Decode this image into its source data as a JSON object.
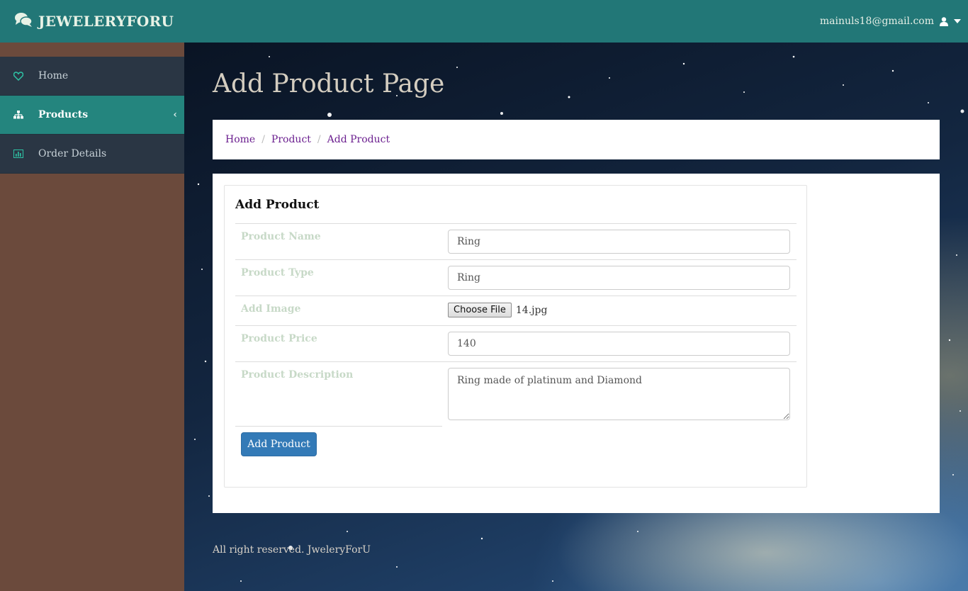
{
  "header": {
    "brand": "JEWELERYFORU",
    "user_email": "mainuls18@gmail.com"
  },
  "sidebar": {
    "items": [
      {
        "label": "Home",
        "icon": "heart-icon"
      },
      {
        "label": "Products",
        "icon": "sitemap-icon",
        "active": true
      },
      {
        "label": "Order Details",
        "icon": "bar-chart-icon"
      }
    ]
  },
  "page": {
    "title": "Add Product Page",
    "breadcrumb": [
      "Home",
      "Product",
      "Add Product"
    ],
    "footer": "All right reserved. JweleryForU"
  },
  "form": {
    "title": "Add Product",
    "product_name": {
      "label": "Product Name",
      "value": "Ring"
    },
    "product_type": {
      "label": "Product Type",
      "value": "Ring"
    },
    "image": {
      "label": "Add Image",
      "button": "Choose File",
      "file_name": "14.jpg"
    },
    "product_price": {
      "label": "Product Price",
      "value": "140"
    },
    "product_description": {
      "label": "Product Description",
      "value": "Ring made of platinum and Diamond"
    },
    "submit_label": "Add Product"
  },
  "colors": {
    "topbar": "#227777",
    "sidebar_bg": "#6b4a3c",
    "sidebar_item": "#2a3644",
    "sidebar_active": "#24857e",
    "link": "#6b1f8f",
    "primary_button": "#337ab7"
  }
}
